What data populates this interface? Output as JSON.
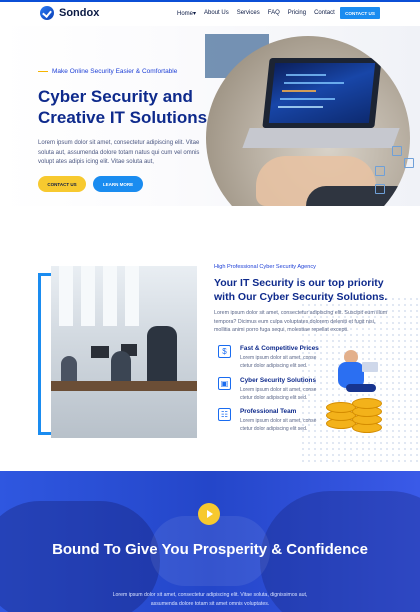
{
  "nav": {
    "logo_text": "Sondox",
    "items": [
      "Home",
      "About Us",
      "Services",
      "FAQ",
      "Pricing",
      "Contact"
    ],
    "dropdown_marker": "▾",
    "contact_button": "CONTACT US"
  },
  "hero": {
    "kicker": "Make Online Security Easier & Comfortable",
    "title": "Cyber Security and Creative IT Solutions",
    "text": "Lorem ipsum dolor sit amet, consectetur adipiscing elit. Vitae soluta aut, assumenda dolore totam natus qui cum vel omnis volupt ates adipis icing elit. Vitae soluta aut,",
    "btn_contact": "CONTACT US",
    "btn_learn": "LEARN MORE"
  },
  "security": {
    "kicker": "High Professional Cyber Security Agency",
    "title": "Your IT Security is our top priority with Our Cyber Security Solutions.",
    "text": "Lorem ipsum dolor sit amet, consectetur adipiscing elit. Suscipit eum illum tempora? Dicimus eum culpa voluptates dolorem deleniti et fugit nisi, mollitia animi porro fuga sequi, molestiae repellat excepti.",
    "features": [
      {
        "title": "Fast & Competitive Prices",
        "text": "Lorem ipsum dolor sit amet, conse ctetur dolor adipiscing elit sed.",
        "icon": "price-tag-icon"
      },
      {
        "title": "Cyber Security Solutions",
        "text": "Lorem ipsum dolor sit amet, conse ctetur dolor adipiscing elit sed.",
        "icon": "chip-icon"
      },
      {
        "title": "Professional Team",
        "text": "Lorem ipsum dolor sit amet, conse ctetur dolor adipiscing elit sed.",
        "icon": "team-icon"
      }
    ]
  },
  "banner": {
    "title": "Bound To Give You Prosperity & Confidence",
    "text": "Lorem ipsum dolor sit amet, consectetur adipiscing elit. Vitae soluta, dignissimos aut, assumenda dolore totam sit amet omnis voluptates."
  },
  "colors": {
    "primary": "#0e2a8c",
    "accent_blue": "#1a8cf0",
    "accent_yellow": "#f7c92f",
    "banner": "#2446c9"
  }
}
